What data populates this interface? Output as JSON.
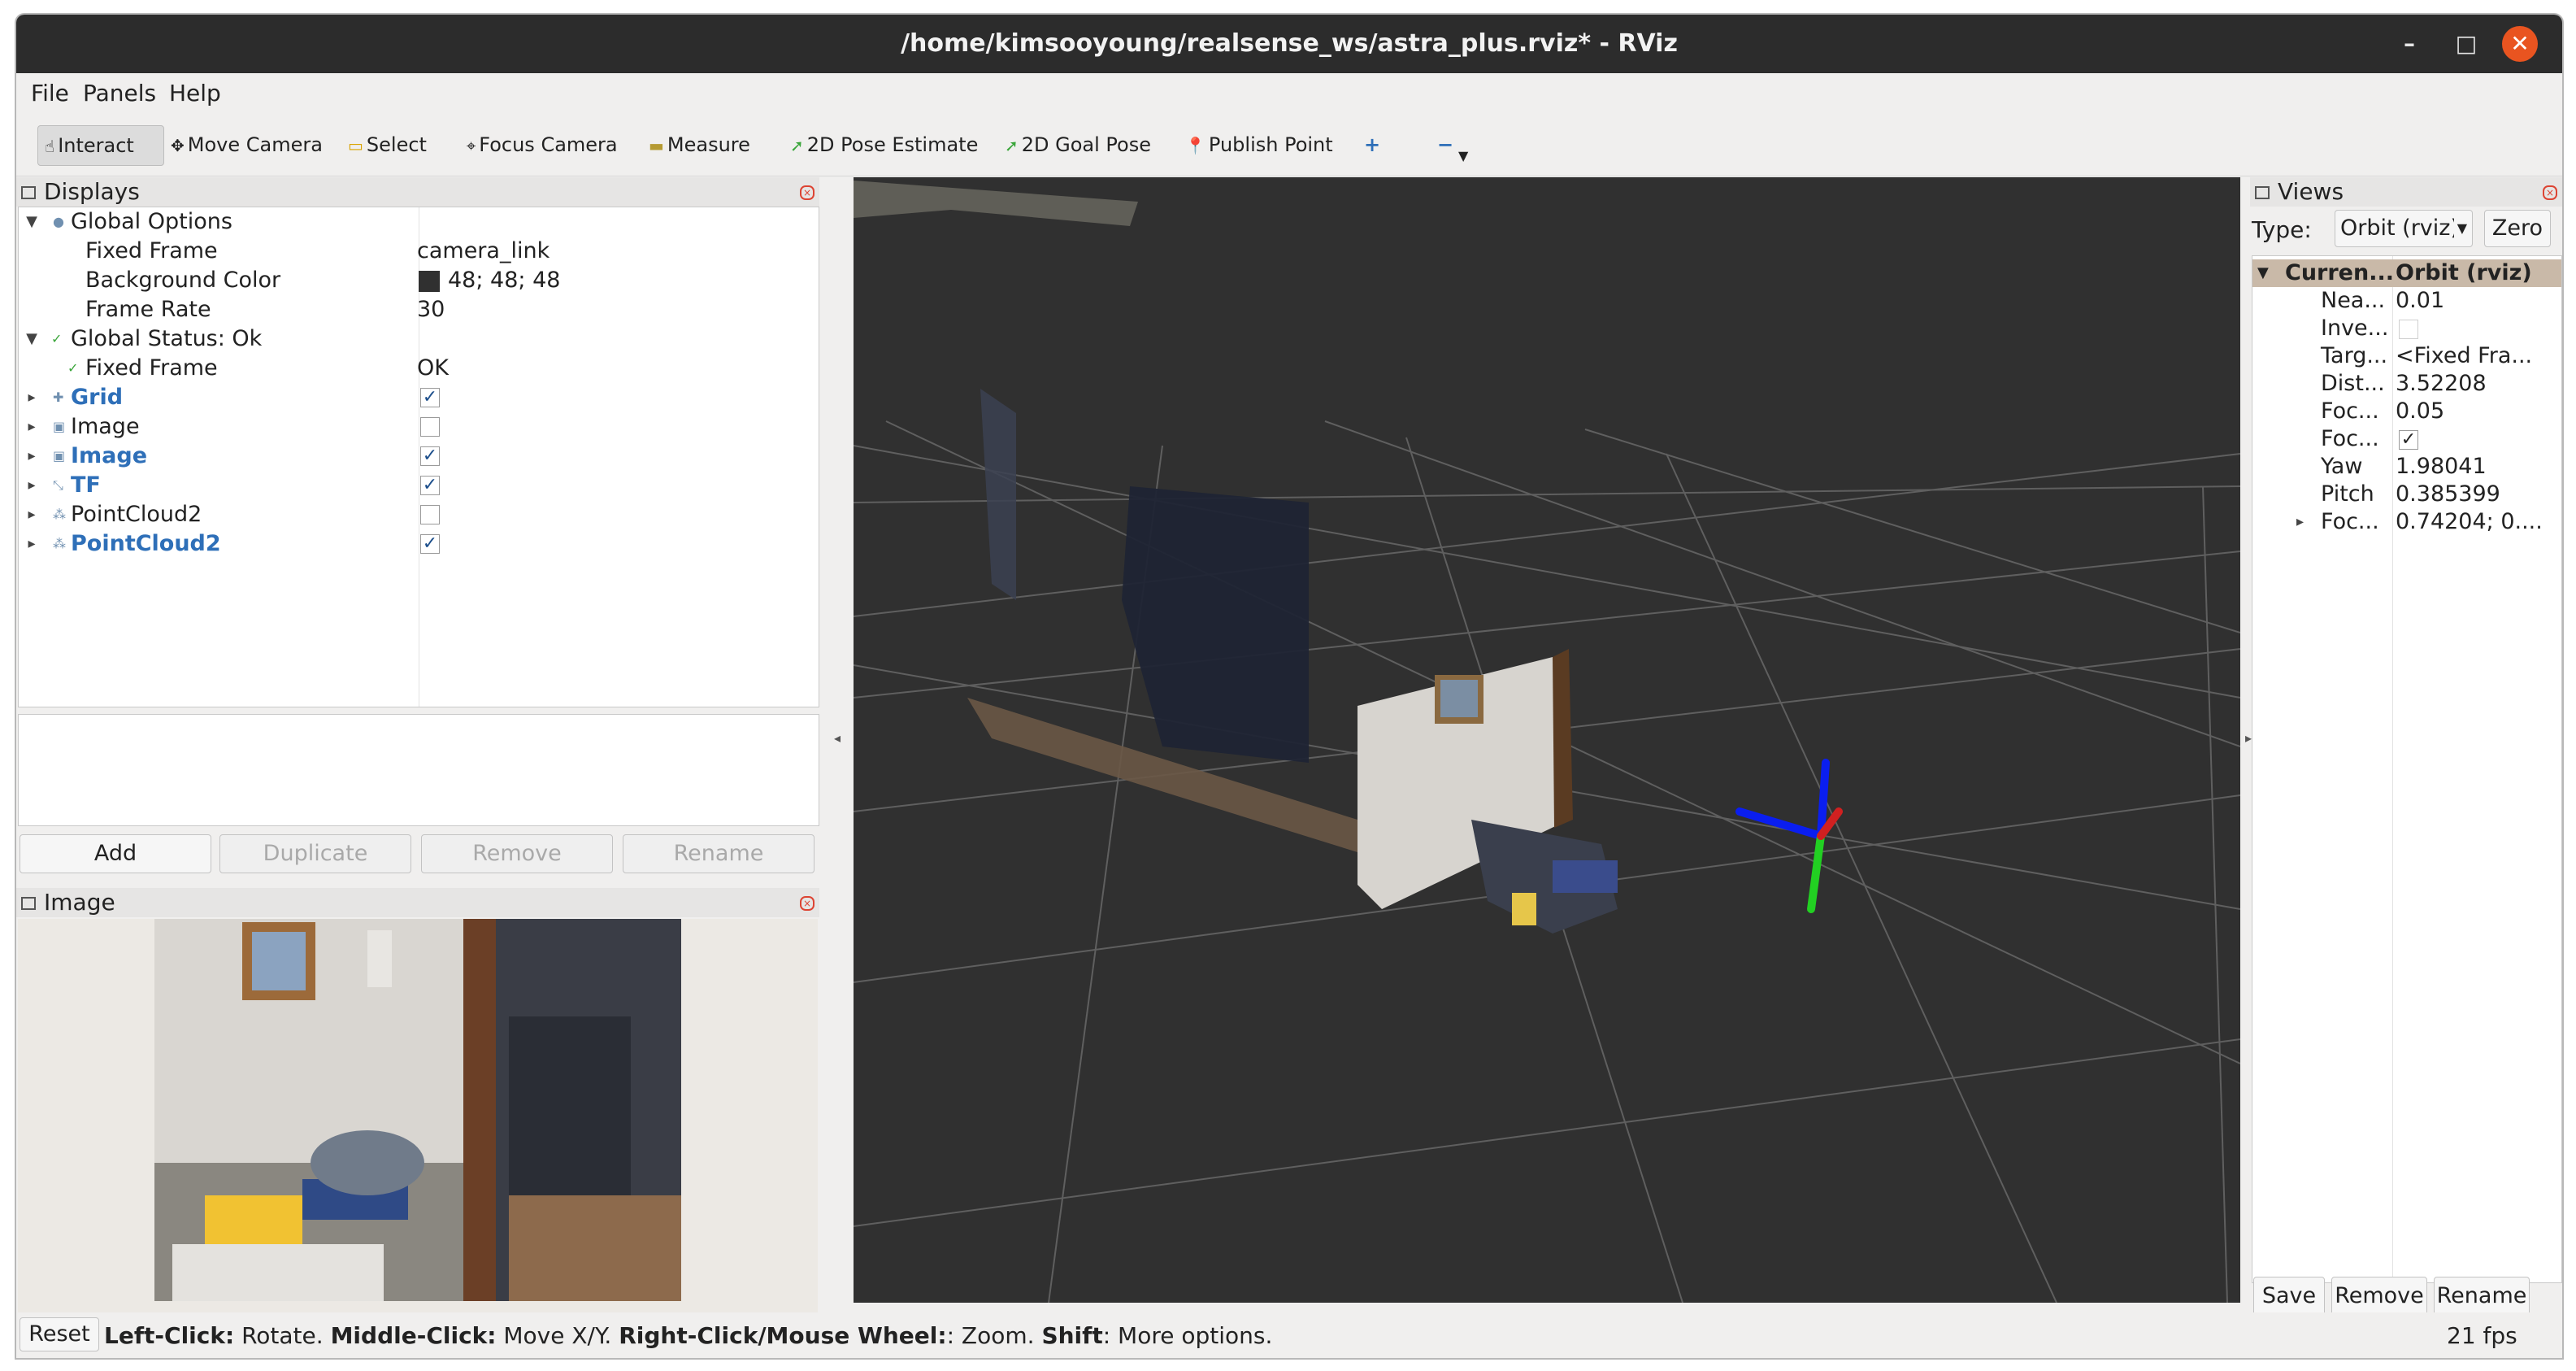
{
  "window": {
    "title": "/home/kimsooyoung/realsense_ws/astra_plus.rviz* - RViz",
    "minimize": "–",
    "maximize": "□",
    "close": "✕"
  },
  "menu": [
    "File",
    "Panels",
    "Help"
  ],
  "toolbar": {
    "tools": [
      "Interact",
      "Move Camera",
      "Select",
      "Focus Camera",
      "Measure",
      "2D Pose Estimate",
      "2D Goal Pose",
      "Publish Point"
    ],
    "add_tool": "+",
    "remove_tool": "−"
  },
  "displays": {
    "title": "Displays",
    "global_options": {
      "label": "Global Options",
      "fixed_frame": {
        "label": "Fixed Frame",
        "value": "camera_link"
      },
      "background_color": {
        "label": "Background Color",
        "value": "48; 48; 48",
        "swatch": "#303030"
      },
      "frame_rate": {
        "label": "Frame Rate",
        "value": "30"
      }
    },
    "global_status": {
      "label": "Global Status: Ok",
      "fixed_frame": {
        "label": "Fixed Frame",
        "value": "OK"
      }
    },
    "items": [
      {
        "label": "Grid",
        "enabled": true
      },
      {
        "label": "Image",
        "enabled": false
      },
      {
        "label": "Image",
        "enabled": true
      },
      {
        "label": "TF",
        "enabled": true
      },
      {
        "label": "PointCloud2",
        "enabled": false
      },
      {
        "label": "PointCloud2",
        "enabled": true
      }
    ],
    "buttons": {
      "add": "Add",
      "duplicate": "Duplicate",
      "remove": "Remove",
      "rename": "Rename"
    }
  },
  "image_panel": {
    "title": "Image"
  },
  "views": {
    "title": "Views",
    "type_label": "Type:",
    "type_value": "Orbit (rviz)",
    "zero_button": "Zero",
    "current": {
      "label": "Curren...",
      "value": "Orbit (rviz)"
    },
    "props": [
      {
        "label": "Nea...",
        "value": "0.01"
      },
      {
        "label": "Inve...",
        "value": ""
      },
      {
        "label": "Targ...",
        "value": "<Fixed Fra..."
      },
      {
        "label": "Dist...",
        "value": "3.52208"
      },
      {
        "label": "Foc...",
        "value": "0.05"
      },
      {
        "label": "Foc...",
        "value": ""
      },
      {
        "label": "Yaw",
        "value": "1.98041"
      },
      {
        "label": "Pitch",
        "value": "0.385399"
      },
      {
        "label": "Foc...",
        "value": "0.74204; 0...."
      }
    ],
    "buttons": {
      "save": "Save",
      "remove": "Remove",
      "rename": "Rename"
    }
  },
  "status": {
    "reset": "Reset",
    "hint_left_key": "Left-Click:",
    "hint_left_val": " Rotate. ",
    "hint_mid_key": "Middle-Click:",
    "hint_mid_val": " Move X/Y. ",
    "hint_right_key": "Right-Click/Mouse Wheel:",
    "hint_right_val": ": Zoom. ",
    "hint_shift_key": "Shift",
    "hint_shift_val": ": More options.",
    "fps": "21 fps"
  }
}
